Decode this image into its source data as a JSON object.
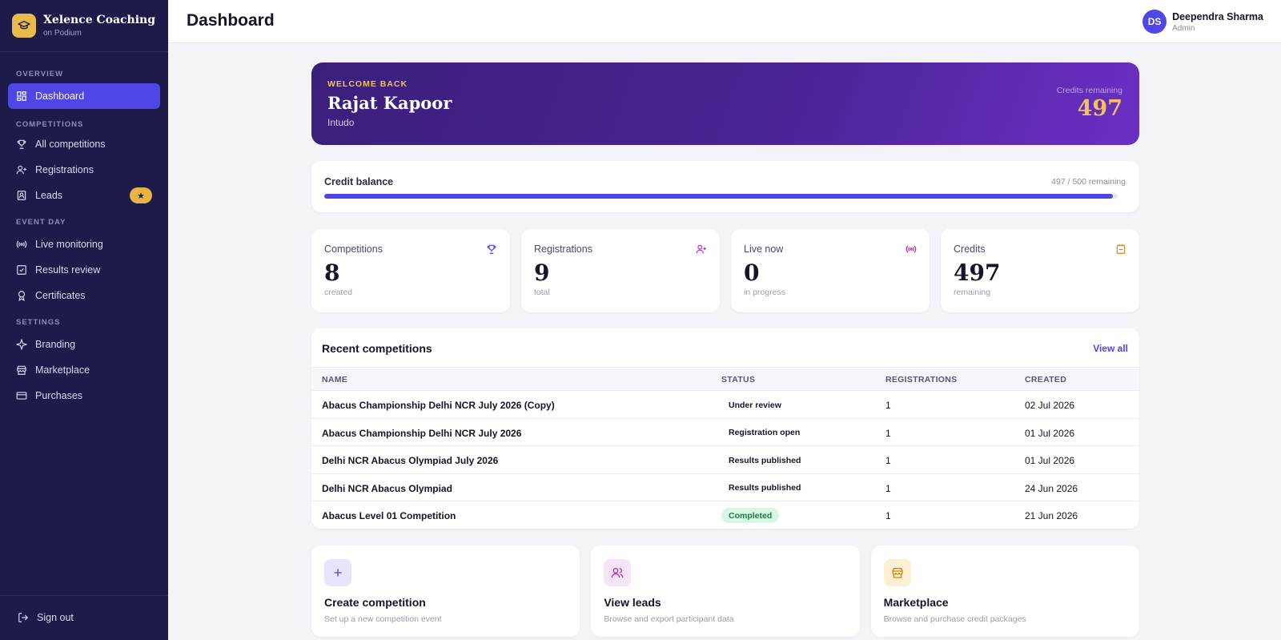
{
  "brand": {
    "name": "Xelence Coaching",
    "sub": "on Podium",
    "logo_icon": "graduation-cap-icon",
    "logo_color": "#e9b949"
  },
  "sidebar": {
    "sections": {
      "overview": "OVERVIEW",
      "competitions": "COMPETITIONS",
      "event_day": "EVENT DAY",
      "settings": "SETTINGS"
    },
    "items": [
      {
        "label": "Dashboard",
        "icon": "dashboard-grid-icon",
        "active": true
      },
      {
        "label": "All competitions",
        "icon": "trophy-icon"
      },
      {
        "label": "Registrations",
        "icon": "user-plus-icon"
      },
      {
        "label": "Leads",
        "icon": "contact-book-icon",
        "badge": "★"
      },
      {
        "label": "Live monitoring",
        "icon": "broadcast-icon"
      },
      {
        "label": "Results review",
        "icon": "checkbox-icon"
      },
      {
        "label": "Certificates",
        "icon": "award-ribbon-icon"
      },
      {
        "label": "Branding",
        "icon": "sparkle-icon"
      },
      {
        "label": "Marketplace",
        "icon": "store-icon"
      },
      {
        "label": "Purchases",
        "icon": "credit-card-icon"
      }
    ],
    "signout": "Sign out"
  },
  "header": {
    "title": "Dashboard",
    "user": {
      "initials": "DS",
      "name": "Deependra Sharma",
      "role": "Admin"
    }
  },
  "hero": {
    "eyebrow": "WELCOME BACK",
    "name": "Rajat Kapoor",
    "org": "Intudo",
    "credits_label": "Credits remaining",
    "credits_value": "497"
  },
  "credit_balance": {
    "title": "Credit balance",
    "remaining_text": "497 / 500 remaining",
    "used": 497,
    "total": 500
  },
  "stats": [
    {
      "label": "Competitions",
      "value": "8",
      "sub": "created",
      "icon": "trophy-icon",
      "color": "#4f46e5"
    },
    {
      "label": "Registrations",
      "value": "9",
      "sub": "total",
      "icon": "user-plus-icon",
      "color": "#b02fc4"
    },
    {
      "label": "Live now",
      "value": "0",
      "sub": "in progress",
      "icon": "broadcast-icon",
      "color": "#c0268f"
    },
    {
      "label": "Credits",
      "value": "497",
      "sub": "remaining",
      "icon": "wallet-icon",
      "color": "#c98a12"
    }
  ],
  "recent": {
    "title": "Recent competitions",
    "view_all": "View all",
    "columns": [
      "NAME",
      "STATUS",
      "REGISTRATIONS",
      "CREATED"
    ],
    "rows": [
      {
        "name": "Abacus Championship Delhi NCR July 2026 (Copy)",
        "status": "Under review",
        "registrations": "1",
        "created": "02 Jul 2026"
      },
      {
        "name": "Abacus Championship Delhi NCR July 2026",
        "status": "Registration open",
        "registrations": "1",
        "created": "01 Jul 2026"
      },
      {
        "name": "Delhi NCR Abacus Olympiad July 2026",
        "status": "Results published",
        "registrations": "1",
        "created": "01 Jul 2026"
      },
      {
        "name": "Delhi NCR Abacus Olympiad",
        "status": "Results published",
        "registrations": "1",
        "created": "24 Jun 2026"
      },
      {
        "name": "Abacus Level 01 Competition",
        "status": "Completed",
        "registrations": "1",
        "created": "21 Jun 2026"
      }
    ]
  },
  "actions": [
    {
      "title": "Create competition",
      "sub": "Set up a new competition event",
      "icon": "plus-icon",
      "bg": "#e6e5fb",
      "color": "#4f46e5"
    },
    {
      "title": "View leads",
      "sub": "Browse and export participant data",
      "icon": "users-icon",
      "bg": "#f5e3f7",
      "color": "#b02fc4"
    },
    {
      "title": "Marketplace",
      "sub": "Browse and purchase credit packages",
      "icon": "store-icon",
      "bg": "#fcefd2",
      "color": "#c98a12"
    }
  ]
}
